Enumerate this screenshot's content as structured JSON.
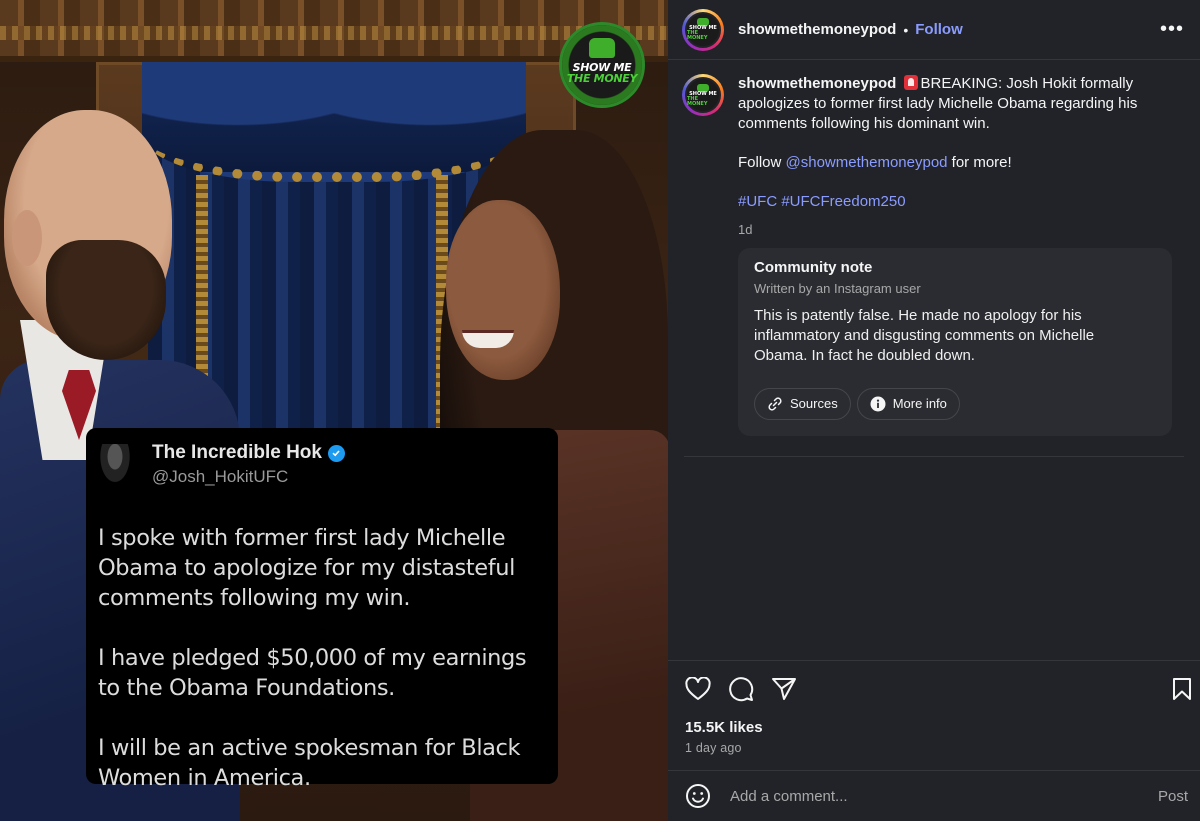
{
  "header": {
    "username": "showmethemoneypod",
    "separator": "•",
    "follow_label": "Follow",
    "more_label": "•••"
  },
  "media": {
    "badge_line1": "SHOW ME",
    "badge_line2": "THE MONEY",
    "tweet": {
      "name": "The Incredible Hok",
      "handle": "@Josh_HokitUFC",
      "paragraph1": "I spoke with former first lady Michelle Obama to apologize for my distasteful comments following my win.",
      "paragraph2": "I have pledged $50,000 of my earnings to the Obama Foundations.",
      "paragraph3": "I will be an active spokesman for Black Women in America."
    }
  },
  "caption": {
    "username": "showmethemoneypod",
    "text": "BREAKING: Josh Hokit formally apologizes to former first lady Michelle Obama regarding his comments following his dominant win.",
    "follow_prefix": "Follow ",
    "mention": "@showmethemoneypod",
    "follow_suffix": " for more!",
    "hashtag1": "#UFC",
    "hashtag2": "#UFCFreedom250",
    "time_ago": "1d"
  },
  "community_note": {
    "title": "Community note",
    "subtitle": "Written by an Instagram user",
    "body": "This is patently false. He made no apology for his inflammatory and disgusting comments on Michelle Obama. In fact he doubled down.",
    "sources_label": "Sources",
    "more_info_label": "More info"
  },
  "engagement": {
    "likes": "15.5K likes",
    "posted": "1 day ago"
  },
  "comment": {
    "placeholder": "Add a comment...",
    "post_label": "Post"
  },
  "colors": {
    "link": "#8b9cff",
    "panel_bg": "#212328",
    "verified": "#1d9bf0"
  }
}
